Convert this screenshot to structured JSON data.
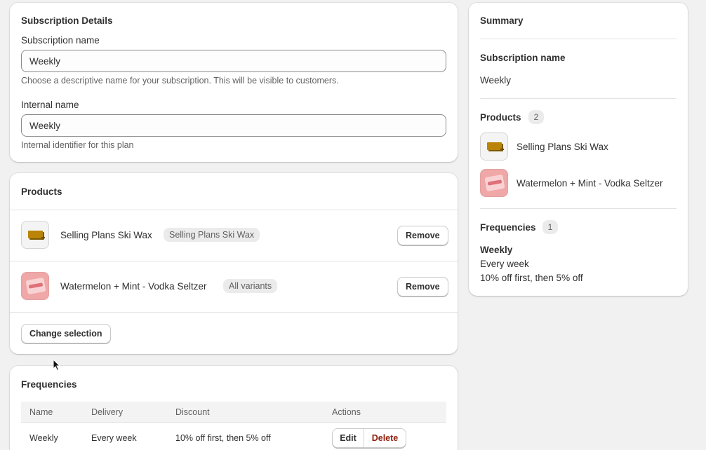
{
  "subscription_details": {
    "title": "Subscription Details",
    "subscription_name_label": "Subscription name",
    "subscription_name_value": "Weekly",
    "subscription_name_help": "Choose a descriptive name for your subscription. This will be visible to customers.",
    "internal_name_label": "Internal name",
    "internal_name_value": "Weekly",
    "internal_name_help": "Internal identifier for this plan"
  },
  "products": {
    "title": "Products",
    "items": [
      {
        "name": "Selling Plans Ski Wax",
        "badge": "Selling Plans Ski Wax",
        "remove_label": "Remove",
        "thumb": "ski-wax"
      },
      {
        "name": "Watermelon + Mint - Vodka Seltzer",
        "badge": "All variants",
        "remove_label": "Remove",
        "thumb": "seltzer-can"
      }
    ],
    "change_selection_label": "Change selection"
  },
  "frequencies": {
    "title": "Frequencies",
    "columns": [
      "Name",
      "Delivery",
      "Discount",
      "Actions"
    ],
    "rows": [
      {
        "name": "Weekly",
        "delivery": "Every week",
        "discount": "10% off first, then 5% off",
        "edit_label": "Edit",
        "delete_label": "Delete"
      }
    ]
  },
  "summary": {
    "title": "Summary",
    "subscription_name_label": "Subscription name",
    "subscription_name_value": "Weekly",
    "products_label": "Products",
    "products_count": "2",
    "products": [
      "Selling Plans Ski Wax",
      "Watermelon + Mint - Vodka Seltzer"
    ],
    "frequencies_label": "Frequencies",
    "frequencies_count": "1",
    "frequency_name": "Weekly",
    "frequency_delivery": "Every week",
    "frequency_discount": "10% off first, then 5% off"
  },
  "colors": {
    "background": "#f1f1f1",
    "card": "#ffffff",
    "delete_text": "#8e1f0b"
  }
}
